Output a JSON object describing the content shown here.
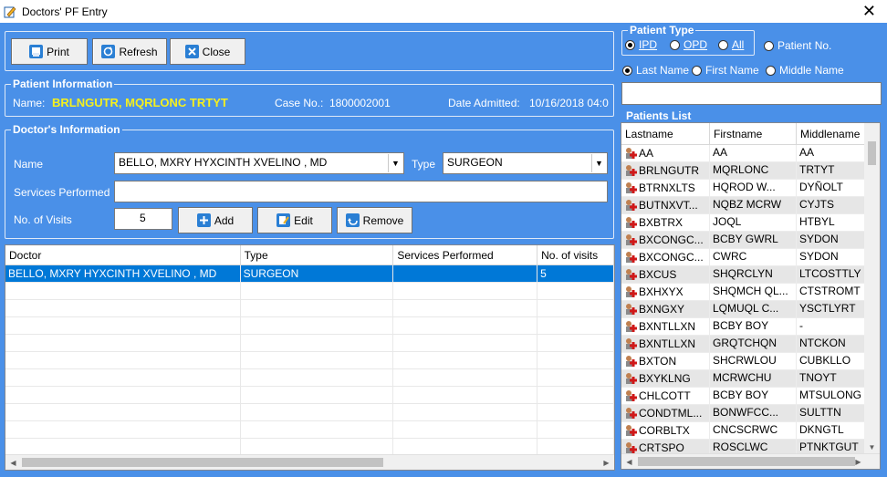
{
  "window": {
    "title": "Doctors' PF Entry"
  },
  "toolbar": {
    "print_label": "Print",
    "refresh_label": "Refresh",
    "close_label": "Close"
  },
  "patient_info": {
    "group_title": "Patient Information",
    "name_label": "Name:",
    "name_value": "BRLNGUTR, MQRLONC TRTYT",
    "case_label": "Case No.:",
    "case_value": "1800002001",
    "admitted_label": "Date Admitted:",
    "admitted_value": "10/16/2018 04:0"
  },
  "doctor_info": {
    "group_title": "Doctor's Information",
    "name_label": "Name",
    "name_value": "BELLO, MXRY HYXCINTH XVELINO , MD",
    "type_label": "Type",
    "type_value": "SURGEON",
    "services_label": "Services Performed",
    "services_value": "",
    "visits_label": "No. of Visits",
    "visits_value": "5",
    "add_label": "Add",
    "edit_label": "Edit",
    "remove_label": "Remove"
  },
  "doctor_grid": {
    "headers": [
      "Doctor",
      "Type",
      "Services Performed",
      "No. of visits"
    ],
    "rows": [
      [
        "BELLO, MXRY HYXCINTH XVELINO , MD",
        "SURGEON",
        "",
        "5"
      ]
    ]
  },
  "patient_type": {
    "group_title": "Patient Type",
    "options": {
      "ipd": "IPD",
      "opd": "OPD",
      "all": "All"
    },
    "selected": "IPD",
    "patient_no_label": "Patient No."
  },
  "search_by": {
    "last": "Last Name",
    "first": "First Name",
    "middle": "Middle Name",
    "selected": "Last Name"
  },
  "search": {
    "value": ""
  },
  "patients": {
    "group_title": "Patients List",
    "headers": [
      "Lastname",
      "Firstname",
      "Middlename"
    ],
    "rows": [
      [
        "AA",
        "AA",
        "AA"
      ],
      [
        "BRLNGUTR",
        "MQRLONC",
        "TRTYT"
      ],
      [
        "BTRNXLTS",
        "HQROD W...",
        "DYÑOLT"
      ],
      [
        "BUTNXVT...",
        "NQBZ MCRW",
        "CYJTS"
      ],
      [
        "BXBTRX",
        "JOQL",
        "HTBYL"
      ],
      [
        "BXCONGC...",
        "BCBY GWRL",
        "SYDON"
      ],
      [
        "BXCONGC...",
        "CWRC",
        "SYDON"
      ],
      [
        "BXCUS",
        "SHQRCLYN",
        "LTCOSTTLY"
      ],
      [
        "BXHXYX",
        "SHQMCH QL...",
        "CTSTROMT"
      ],
      [
        "BXNGXY",
        "LQMUQL C...",
        "YSCTLYRT"
      ],
      [
        "BXNTLLXN",
        "BCBY BOY",
        "-"
      ],
      [
        "BXNTLLXN",
        "GRQTCHQN",
        "NTCKON"
      ],
      [
        "BXTON",
        "SHCRWLOU",
        "CUBKLLO"
      ],
      [
        "BXYKLNG",
        "MCRWCHU",
        "TNOYT"
      ],
      [
        "CHLCOTT",
        "BCBY BOY",
        "MTSULONG"
      ],
      [
        "CONDTML...",
        "BONWFCC...",
        "SULTTN"
      ],
      [
        "CORBLTX",
        "CNCSCRWC",
        "DKNGTL"
      ],
      [
        "CRTSPO",
        "ROSCLWC",
        "PTNKTGUT"
      ]
    ]
  },
  "colors": {
    "background": "#4a90e8",
    "selected_row": "#0078d7",
    "highlight_text": "#f5f01d"
  },
  "icons": {
    "print": "printer-icon",
    "refresh": "refresh-icon",
    "close": "close-icon",
    "add": "plus-icon",
    "edit": "edit-icon",
    "remove": "undo-icon",
    "patient": "patient-cross-icon"
  }
}
